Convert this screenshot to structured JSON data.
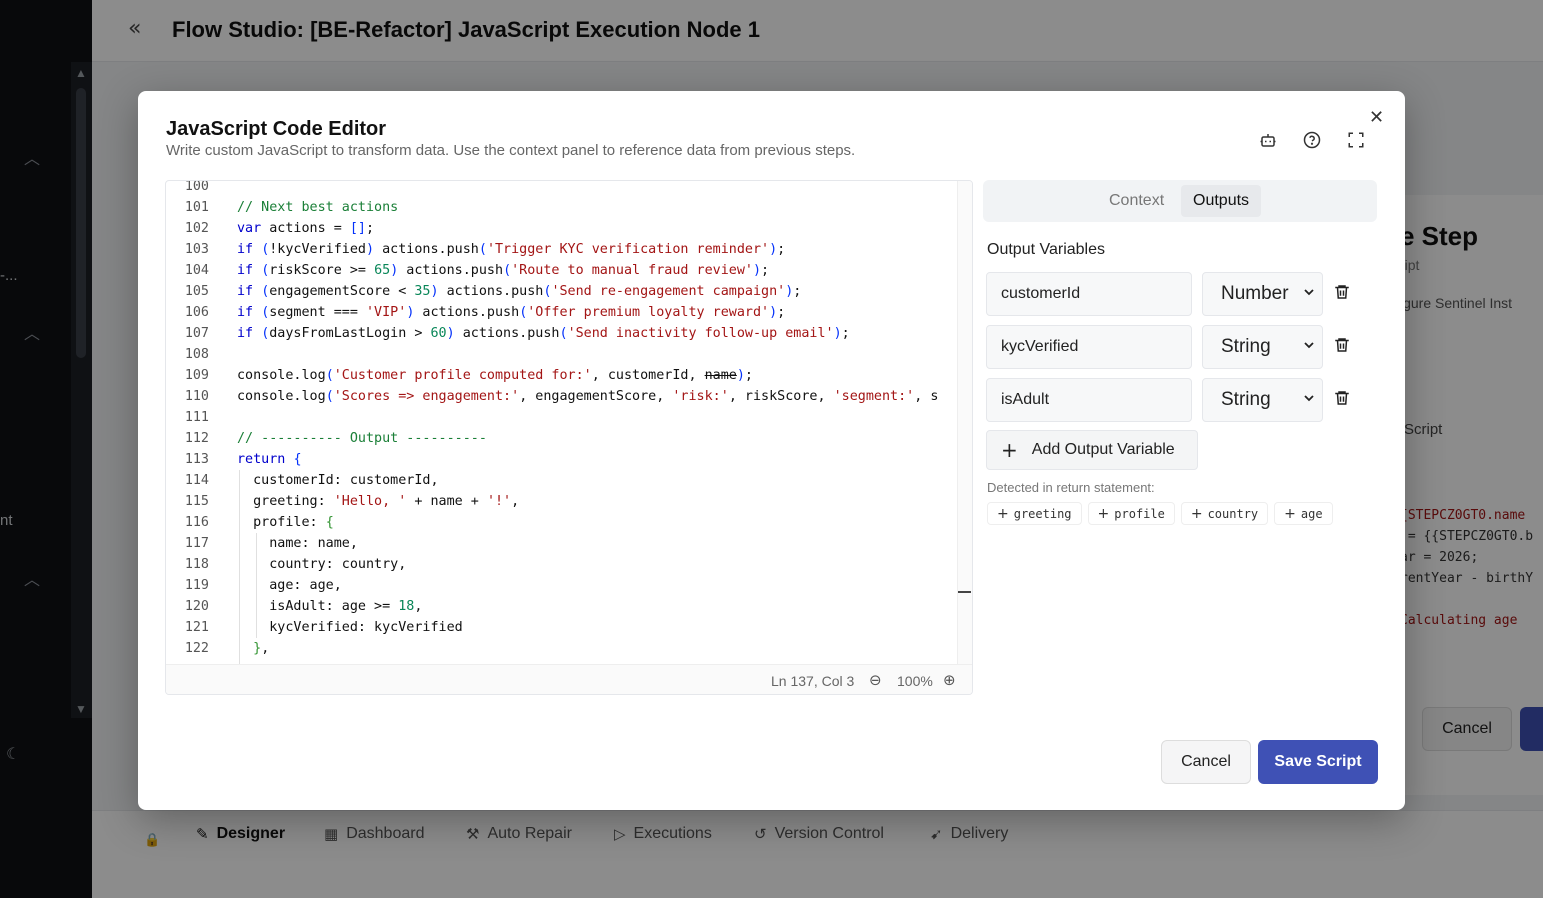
{
  "app": {
    "title": "Flow Studio: [BE-Refactor] JavaScript Execution Node 1",
    "collapse_icon": "double-chevron-left-icon"
  },
  "rail": {
    "truncated_text_1": "-...",
    "truncated_text_2": "nt"
  },
  "background_panel": {
    "title": "e Step",
    "subtitle": "ript",
    "description": "igure Sentinel Inst",
    "label": "Script",
    "code_lines": [
      "{STEPCZ0GT0.name",
      " = {{STEPCZ0GT0.b",
      "ar = 2026;",
      "rentYear - birthY",
      "",
      "Calculating age "
    ],
    "cancel_label": "Cancel"
  },
  "bottom_tabs": [
    {
      "label": "Designer",
      "icon": "wand-icon",
      "active": true
    },
    {
      "label": "Dashboard",
      "icon": "grid-icon",
      "active": false
    },
    {
      "label": "Auto Repair",
      "icon": "wrench-icon",
      "active": false
    },
    {
      "label": "Executions",
      "icon": "play-icon",
      "active": false
    },
    {
      "label": "Version Control",
      "icon": "history-icon",
      "active": false
    },
    {
      "label": "Delivery",
      "icon": "rocket-icon",
      "active": false
    }
  ],
  "modal": {
    "title": "JavaScript Code Editor",
    "subtitle": "Write custom JavaScript to transform data. Use the context panel to reference data from previous steps.",
    "header_icons": [
      "bot-icon",
      "help-circle-icon",
      "fullscreen-icon"
    ],
    "editor": {
      "lines": [
        {
          "n": "100",
          "t": ""
        },
        {
          "n": "101",
          "t": "// Next best actions"
        },
        {
          "n": "102",
          "t": "var actions = [];"
        },
        {
          "n": "103",
          "t": "if (!kycVerified) actions.push('Trigger KYC verification reminder');"
        },
        {
          "n": "104",
          "t": "if (riskScore >= 65) actions.push('Route to manual fraud review');"
        },
        {
          "n": "105",
          "t": "if (engagementScore < 35) actions.push('Send re-engagement campaign');"
        },
        {
          "n": "106",
          "t": "if (segment === 'VIP') actions.push('Offer premium loyalty reward');"
        },
        {
          "n": "107",
          "t": "if (daysFromLastLogin > 60) actions.push('Send inactivity follow-up email');"
        },
        {
          "n": "108",
          "t": ""
        },
        {
          "n": "109",
          "t": "console.log('Customer profile computed for:', customerId, name);"
        },
        {
          "n": "110",
          "t": "console.log('Scores => engagement:', engagementScore, 'risk:', riskScore, 'segment:', s"
        },
        {
          "n": "111",
          "t": ""
        },
        {
          "n": "112",
          "t": "// ---------- Output ----------"
        },
        {
          "n": "113",
          "t": "return {"
        },
        {
          "n": "114",
          "t": "  customerId: customerId,"
        },
        {
          "n": "115",
          "t": "  greeting: 'Hello, ' + name + '!',"
        },
        {
          "n": "116",
          "t": "  profile: {"
        },
        {
          "n": "117",
          "t": "    name: name,"
        },
        {
          "n": "118",
          "t": "    country: country,"
        },
        {
          "n": "119",
          "t": "    age: age,"
        },
        {
          "n": "120",
          "t": "    isAdult: age >= 18,"
        },
        {
          "n": "121",
          "t": "    kycVerified: kycVerified"
        },
        {
          "n": "122",
          "t": "  },"
        }
      ],
      "cursor_position": "Ln 137, Col 3",
      "zoom": "100%"
    },
    "tabs": [
      {
        "label": "Context",
        "active": false
      },
      {
        "label": "Outputs",
        "active": true
      }
    ],
    "outputs": {
      "title": "Output Variables",
      "variables": [
        {
          "name": "customerId",
          "type": "Number"
        },
        {
          "name": "kycVerified",
          "type": "String"
        },
        {
          "name": "isAdult",
          "type": "String"
        }
      ],
      "add_label": "Add Output Variable",
      "detected_label": "Detected in return statement:",
      "detected": [
        "greeting",
        "profile",
        "country",
        "age"
      ]
    },
    "cancel_label": "Cancel",
    "save_label": "Save Script"
  },
  "colors": {
    "primary": "#3f51b5",
    "keyword": "#0000cc",
    "string": "#a31515",
    "number": "#098658",
    "comment": "#1a7f37"
  }
}
